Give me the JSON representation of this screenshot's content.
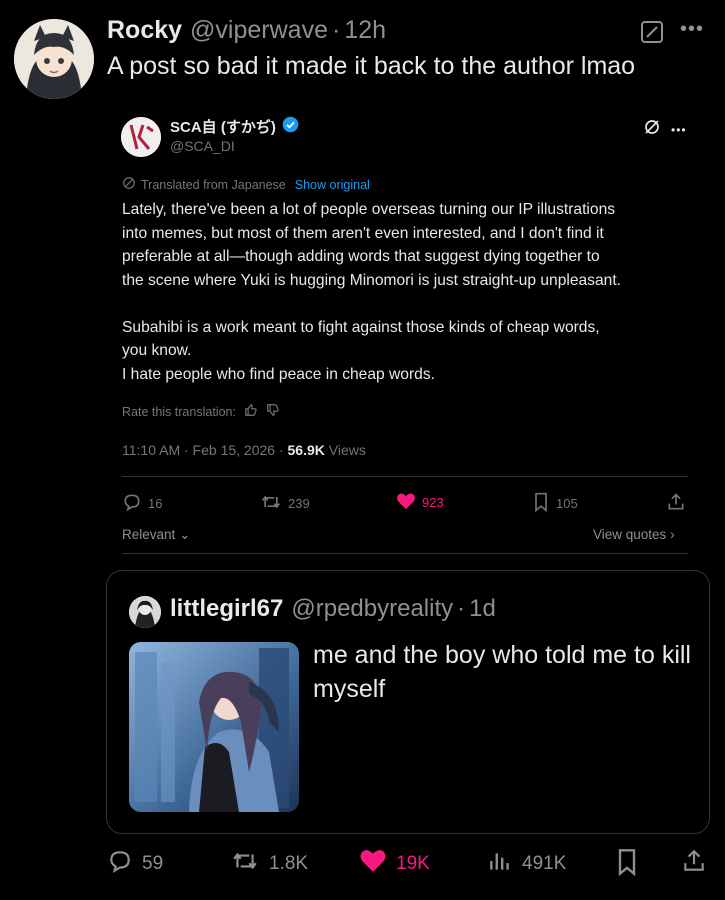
{
  "post": {
    "author_name": "Rocky",
    "author_handle": "@viperwave",
    "dot": "·",
    "time": "12h",
    "text": "A post so bad it made it back to the author lmao"
  },
  "embedded": {
    "name": "SCA自 (すかぢ)",
    "handle": "@SCA_DI",
    "translated_label": "Translated from Japanese",
    "show_original": "Show original",
    "body_lines_1": [
      "Lately, there've been a lot of people overseas turning our IP illustrations",
      "into memes, but most of them aren't even interested, and I don't find it",
      "preferable at all—though adding words that suggest dying together to",
      "the scene where Yuki is hugging Minomori is just straight-up unpleasant."
    ],
    "body_lines_2": [
      "Subahibi is a work meant to fight against those kinds of cheap words,",
      "you know.",
      "I hate people who find peace in cheap words."
    ],
    "rate_label": "Rate this translation:",
    "timestamp": "11:10 AM · Feb 15, 2026 · ",
    "views_count": "56.9K",
    "views_label": " Views",
    "replies": "16",
    "reposts": "239",
    "likes": "923",
    "bookmarks": "105",
    "relevant_label": "Relevant",
    "view_quotes_label": "View quotes"
  },
  "quoted": {
    "name": "littlegirl67",
    "handle": "@rpedbyreality",
    "dot": "·",
    "time": "1d",
    "text": "me and the boy who told me to kill myself"
  },
  "actions": {
    "replies": "59",
    "reposts": "1.8K",
    "likes": "19K",
    "views": "491K"
  },
  "colors": {
    "like": "#f91880",
    "verified": "#1d9bf0",
    "link": "#1d9bf0"
  }
}
